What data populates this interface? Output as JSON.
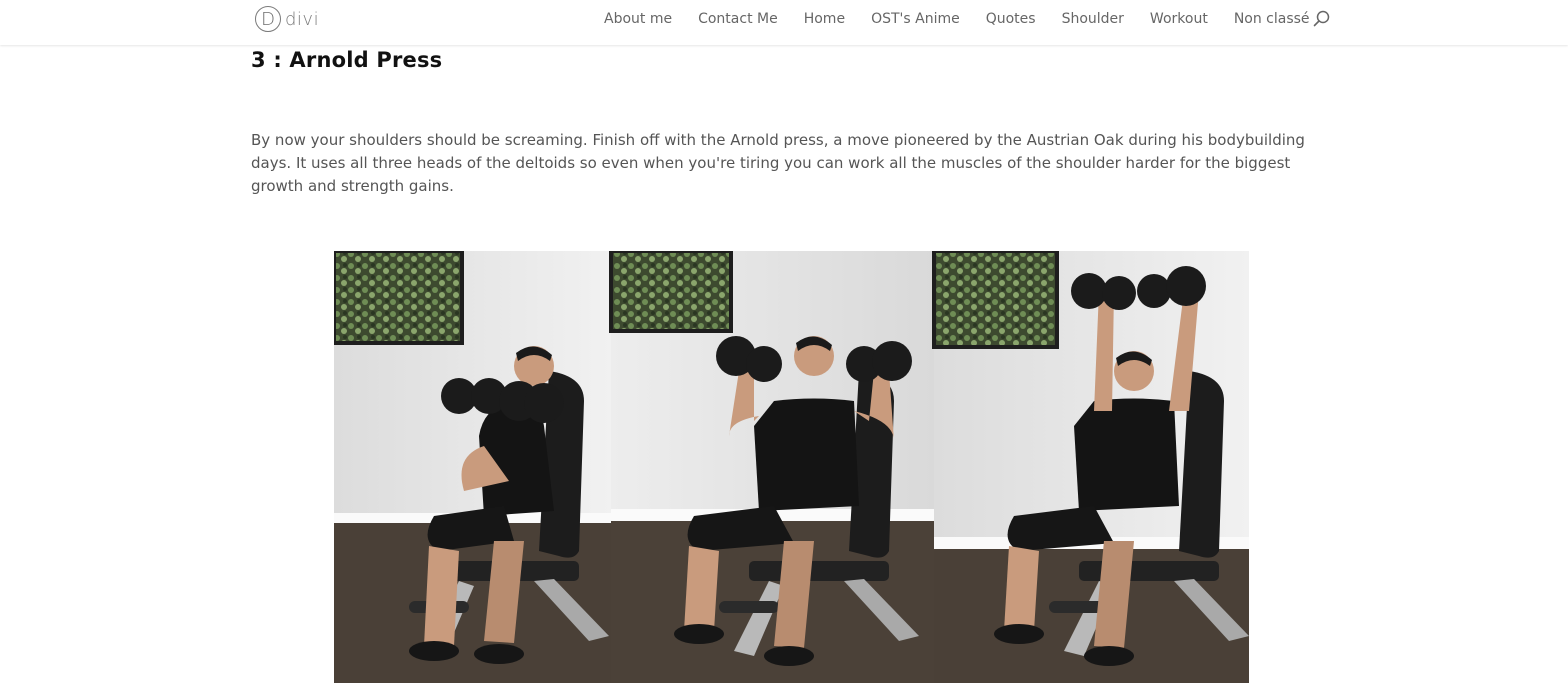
{
  "header": {
    "logo_text": "divi",
    "logo_letter": "D",
    "nav": [
      "About me",
      "Contact Me",
      "Home",
      "OST's Anime",
      "Quotes",
      "Shoulder",
      "Workout",
      "Non classé"
    ],
    "search_icon": "search-icon"
  },
  "article": {
    "heading": "3 : Arnold Press",
    "paragraph": "By now your shoulders should be screaming. Finish off with the Arnold press, a move pioneered by the Austrian Oak during his bodybuilding days. It uses all three heads of the deltoids so even when you're tiring you can work all the muscles of the shoulder harder for the biggest growth and strength gains."
  },
  "colors": {
    "text": "#555555",
    "heading": "#111111",
    "nav": "#666666",
    "background": "#ffffff"
  }
}
